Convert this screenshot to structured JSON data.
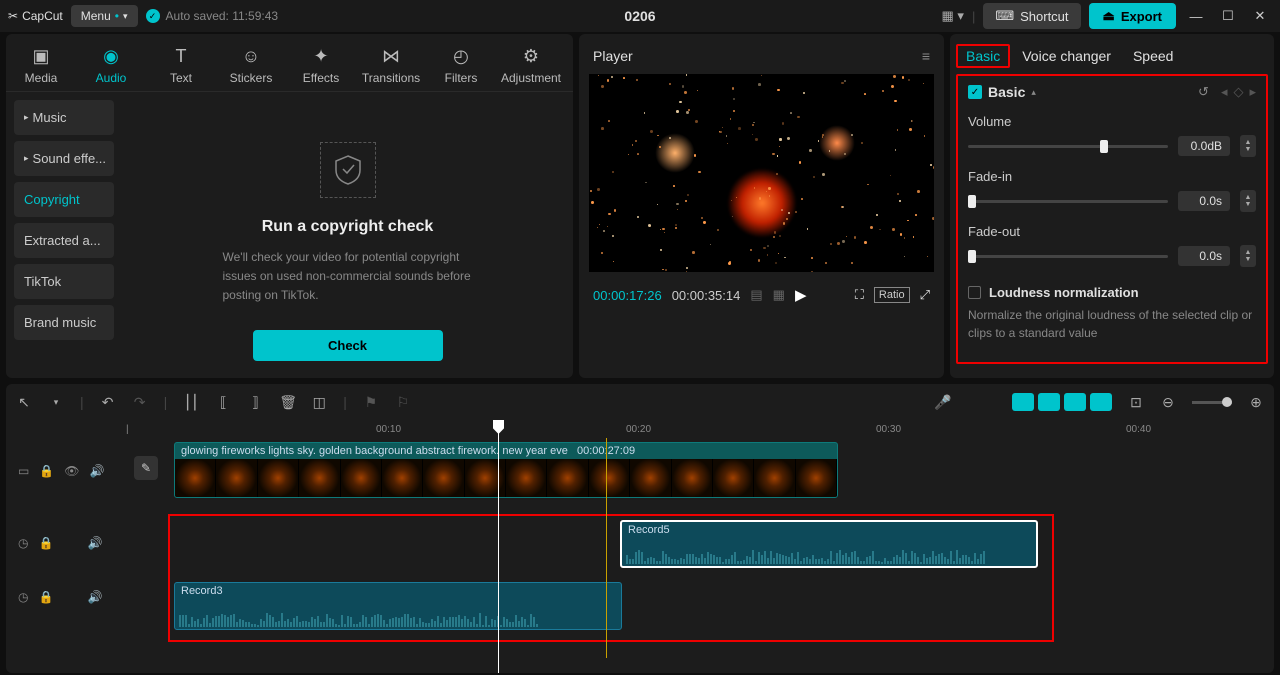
{
  "titlebar": {
    "app_name": "CapCut",
    "menu_label": "Menu",
    "autosave_label": "Auto saved: 11:59:43",
    "project_title": "0206",
    "shortcut_label": "Shortcut",
    "export_label": "Export"
  },
  "tabs": {
    "media": "Media",
    "audio": "Audio",
    "text": "Text",
    "stickers": "Stickers",
    "effects": "Effects",
    "transitions": "Transitions",
    "filters": "Filters",
    "adjustment": "Adjustment"
  },
  "sidebar": {
    "items": [
      {
        "label": "Music",
        "expandable": true
      },
      {
        "label": "Sound effe...",
        "expandable": true
      },
      {
        "label": "Copyright",
        "active": true
      },
      {
        "label": "Extracted a..."
      },
      {
        "label": "TikTok"
      },
      {
        "label": "Brand music"
      }
    ]
  },
  "copyright_pane": {
    "title": "Run a copyright check",
    "description": "We'll check your video for potential copyright issues on used non-commercial sounds before posting on TikTok.",
    "button": "Check"
  },
  "player": {
    "title": "Player",
    "time_current": "00:00:17:26",
    "time_total": "00:00:35:14",
    "ratio_label": "Ratio"
  },
  "props": {
    "tabs": {
      "basic": "Basic",
      "voice": "Voice changer",
      "speed": "Speed"
    },
    "basic_label": "Basic",
    "volume": {
      "label": "Volume",
      "value": "0.0dB",
      "pos": 50
    },
    "fadein": {
      "label": "Fade-in",
      "value": "0.0s",
      "pos": 0
    },
    "fadeout": {
      "label": "Fade-out",
      "value": "0.0s",
      "pos": 0
    },
    "loudness": {
      "title": "Loudness normalization",
      "desc": "Normalize the original loudness of the selected clip or clips to a standard value"
    }
  },
  "timeline": {
    "ruler": [
      "00:10",
      "00:20",
      "00:30",
      "00:40"
    ],
    "video_clip": {
      "title": "glowing fireworks lights sky. golden background abstract firework. new year eve",
      "duration": "00:00:27:09"
    },
    "audio_clips": {
      "record5": "Record5",
      "record3": "Record3"
    }
  }
}
